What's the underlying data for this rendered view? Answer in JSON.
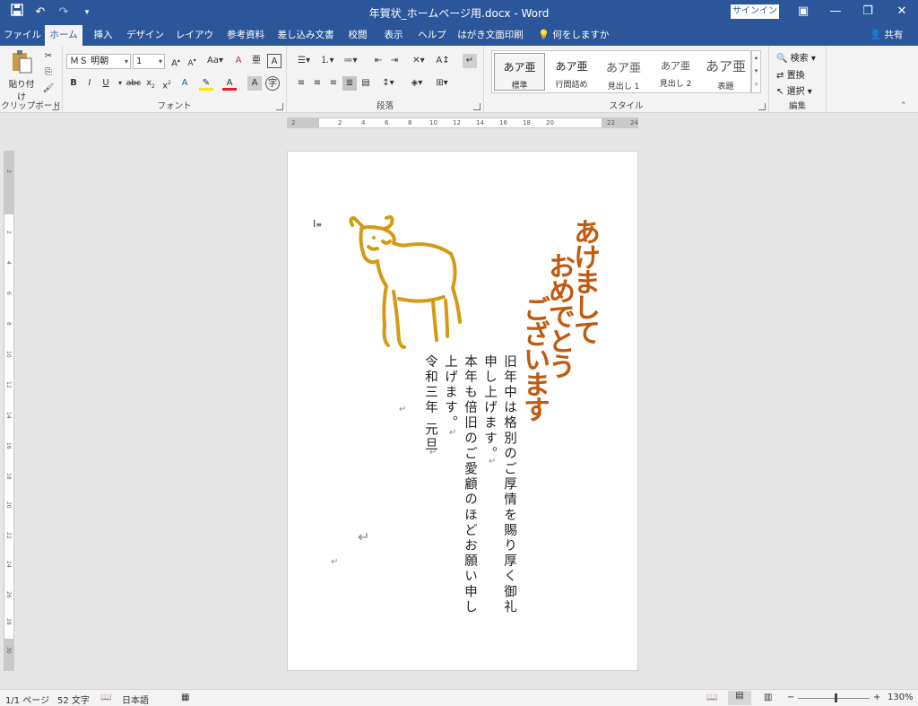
{
  "titlebar": {
    "title": "年賀状_ホームページ用.docx - Word",
    "signin": "サインイン",
    "qat": [
      "save-icon",
      "undo-icon",
      "redo-icon",
      "customize-icon"
    ]
  },
  "tabs": [
    "ファイル",
    "ホーム",
    "挿入",
    "デザイン",
    "レイアウト",
    "参考資料",
    "差し込み文書",
    "校閲",
    "表示",
    "ヘルプ",
    "はがき文面印刷"
  ],
  "active_tab": "ホーム",
  "tellme": "何をしますか",
  "share": "共有",
  "ribbon": {
    "clipboard": {
      "label": "クリップボード",
      "paste": "貼り付け"
    },
    "font": {
      "label": "フォント",
      "font_name": "ＭＳ 明朝",
      "font_size": "1"
    },
    "paragraph": {
      "label": "段落"
    },
    "styles": {
      "label": "スタイル",
      "items": [
        {
          "sample": "あア亜",
          "name": "標準"
        },
        {
          "sample": "あア亜",
          "name": "行間詰め"
        },
        {
          "sample": "あア亜",
          "name": "見出し 1"
        },
        {
          "sample": "あア亜",
          "name": "見出し 2"
        },
        {
          "sample": "あア亜",
          "name": "表題"
        }
      ]
    },
    "editing": {
      "label": "編集",
      "find": "検索",
      "replace": "置換",
      "select": "選択"
    }
  },
  "ruler_ticks": [
    "2",
    "2",
    "4",
    "6",
    "8",
    "10",
    "12",
    "14",
    "16",
    "18",
    "20",
    "22",
    "24"
  ],
  "vruler_ticks": [
    "2",
    "2",
    "4",
    "6",
    "8",
    "10",
    "12",
    "14",
    "16",
    "18",
    "20",
    "22",
    "24",
    "26",
    "28",
    "30"
  ],
  "document": {
    "greeting_lines": [
      "あけまして",
      "おめでとう",
      "ございます"
    ],
    "body_lines": [
      "旧年中は格別のご厚情を賜り厚く御礼",
      "申し上げます。",
      "本年も倍旧のご愛顧のほどお願い申し",
      "上げます。",
      "令和三年 元旦"
    ],
    "greeting_color": "#c05a10",
    "illustration_color": "#d49a14"
  },
  "status": {
    "page": "1/1 ページ",
    "words": "52 文字",
    "language": "日本語",
    "zoom": "130%"
  }
}
